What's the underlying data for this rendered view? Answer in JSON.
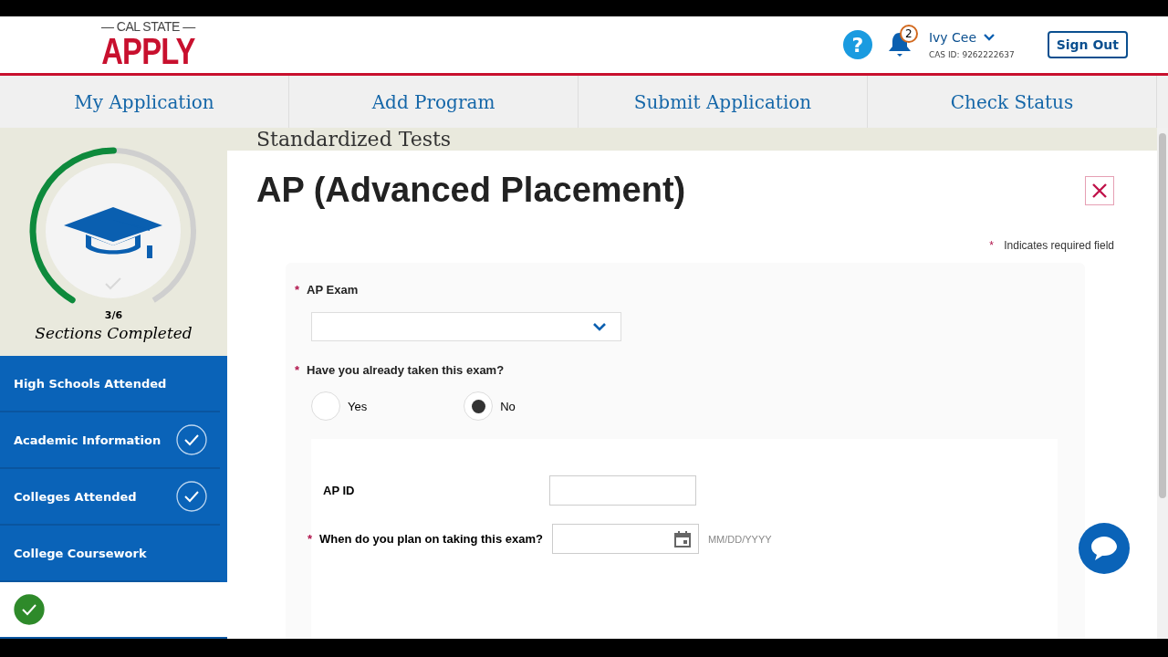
{
  "header": {
    "logo_top": "— CAL STATE —",
    "help": "?",
    "logo_main": "APPLY",
    "notifications": "2",
    "user_name": "Ivy Cee",
    "cas_id": "CAS ID: 9262222637",
    "sign_out": "Sign Out"
  },
  "nav_tabs": [
    "My Application",
    "Add Program",
    "Submit Application",
    "Check Status"
  ],
  "progress": {
    "count": "3/6",
    "caption": "Sections Completed",
    "level": 0.5
  },
  "sidebar": {
    "items": [
      {
        "label": "High Schools Attended",
        "checked": false,
        "selected": false
      },
      {
        "label": "Academic Information",
        "checked": true,
        "selected": false
      },
      {
        "label": "Colleges Attended",
        "checked": true,
        "selected": false
      },
      {
        "label": "College Coursework",
        "checked": false,
        "selected": false
      },
      {
        "checked": true,
        "selected": true
      }
    ]
  },
  "section_title": "Standardized Tests",
  "form": {
    "title": "AP (Advanced Placement)",
    "required_note": "Indicates required field",
    "required_mark": "*",
    "exam_label": "AP Exam",
    "taken_label": "Have you already taken this exam?",
    "options": [
      {
        "label": "Yes",
        "selected": false
      },
      {
        "label": "No",
        "selected": true
      }
    ],
    "ap_id_label": "AP ID",
    "plan_label": "When do you plan on taking this exam?",
    "date_placeholder": "MM/DD/YYYY"
  }
}
